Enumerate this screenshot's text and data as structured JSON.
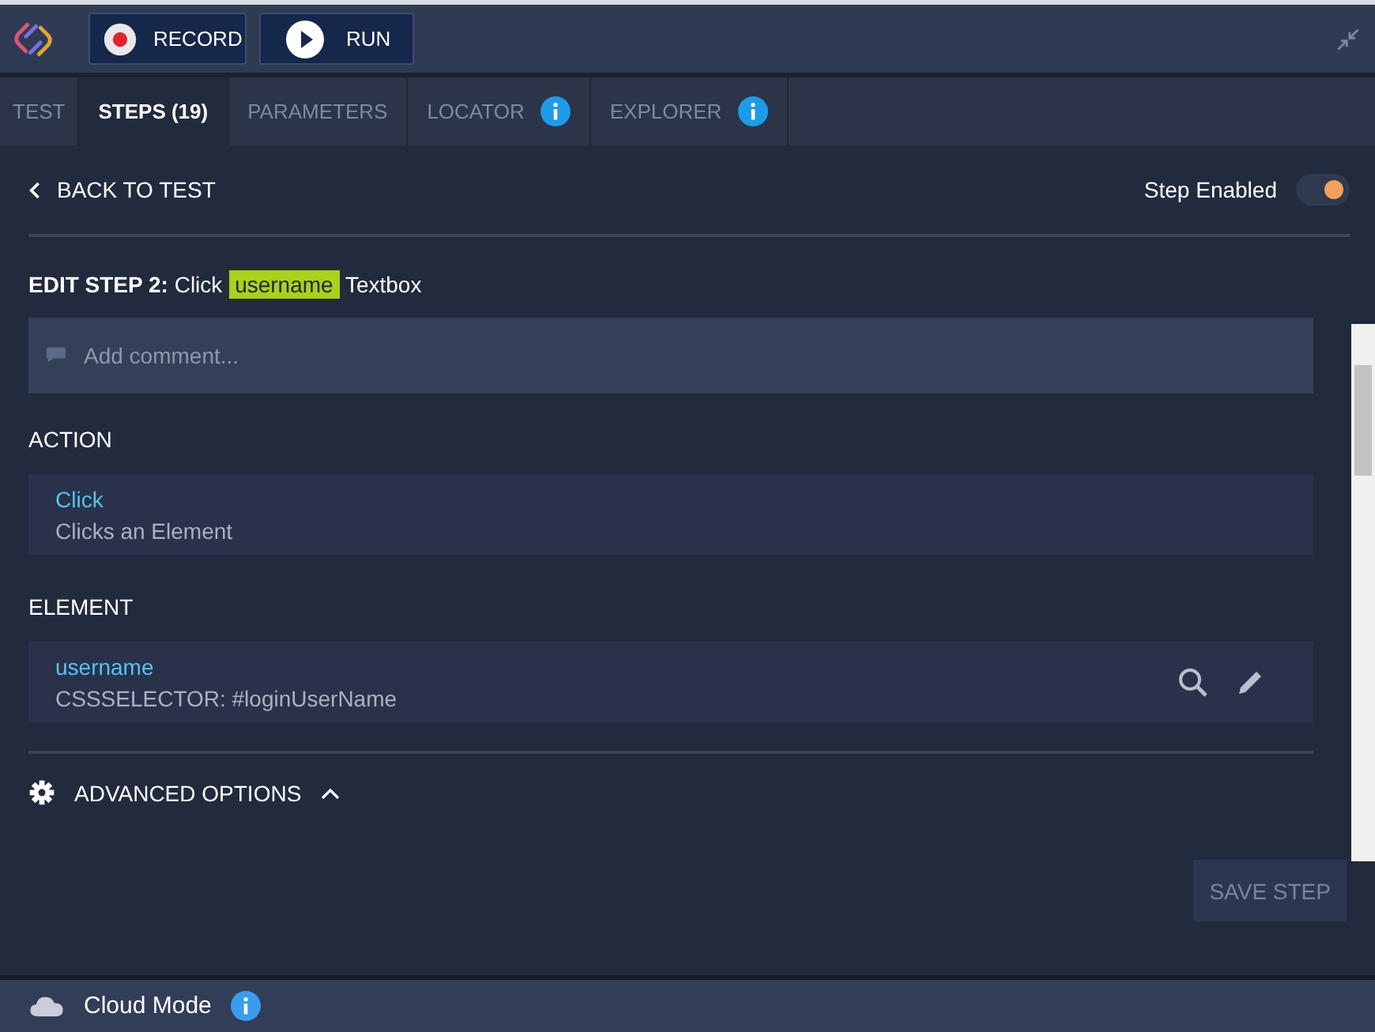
{
  "toolbar": {
    "buttons": [
      {
        "label": "RECORD",
        "kind": "record"
      },
      {
        "label": "RUN",
        "kind": "run"
      }
    ]
  },
  "tabs": [
    {
      "label": "TEST",
      "selected": false,
      "info": false
    },
    {
      "label": "STEPS (19)",
      "selected": true,
      "info": false
    },
    {
      "label": "PARAMETERS",
      "selected": false,
      "info": false
    },
    {
      "label": "LOCATOR",
      "selected": false,
      "info": true
    },
    {
      "label": "EXPLORER",
      "selected": false,
      "info": true
    }
  ],
  "back_link": "BACK TO TEST",
  "step_enabled": {
    "label": "Step Enabled",
    "on": true
  },
  "edit_step": {
    "heading": "EDIT STEP 2:",
    "action": "Click",
    "target": "username",
    "suffix": "Textbox"
  },
  "comment": {
    "placeholder": "Add comment..."
  },
  "action": {
    "heading": "ACTION",
    "name": "Click",
    "description": "Clicks an Element"
  },
  "element": {
    "heading": "ELEMENT",
    "name": "username",
    "locator": "CSSSELECTOR: #loginUserName"
  },
  "advanced_options": {
    "label": "ADVANCED OPTIONS",
    "expanded": true
  },
  "save_button": {
    "label": "SAVE STEP",
    "disabled": true
  },
  "footer": {
    "label": "Cloud Mode",
    "info": true
  }
}
